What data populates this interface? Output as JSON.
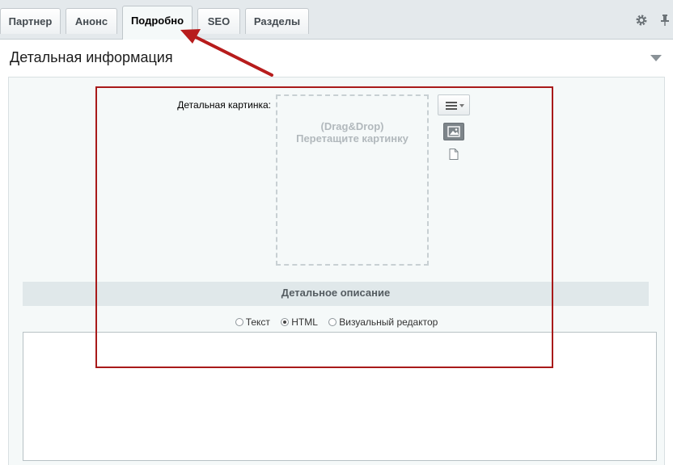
{
  "tabs": [
    {
      "label": "Партнер"
    },
    {
      "label": "Анонс"
    },
    {
      "label": "Подробно",
      "active": true
    },
    {
      "label": "SEO"
    },
    {
      "label": "Разделы"
    }
  ],
  "tab_icons": [
    "gear-icon",
    "pin-icon"
  ],
  "section": {
    "title": "Детальная информация",
    "icon": "chevron-down-icon"
  },
  "picture": {
    "label": "Детальная картинка:",
    "dropzone_line1": "(Drag&Drop)",
    "dropzone_line2": "Перетащите картинку",
    "icons": [
      "menu-icon",
      "image-icon",
      "file-icon"
    ]
  },
  "description": {
    "title": "Детальное описание",
    "modes": [
      {
        "label": "Текст",
        "checked": false
      },
      {
        "label": "HTML",
        "checked": true
      },
      {
        "label": "Визуальный редактор",
        "checked": false
      }
    ],
    "value": ""
  },
  "annotation": {
    "highlight_color": "#a81a1a",
    "arrow_color": "#b71c1c"
  }
}
